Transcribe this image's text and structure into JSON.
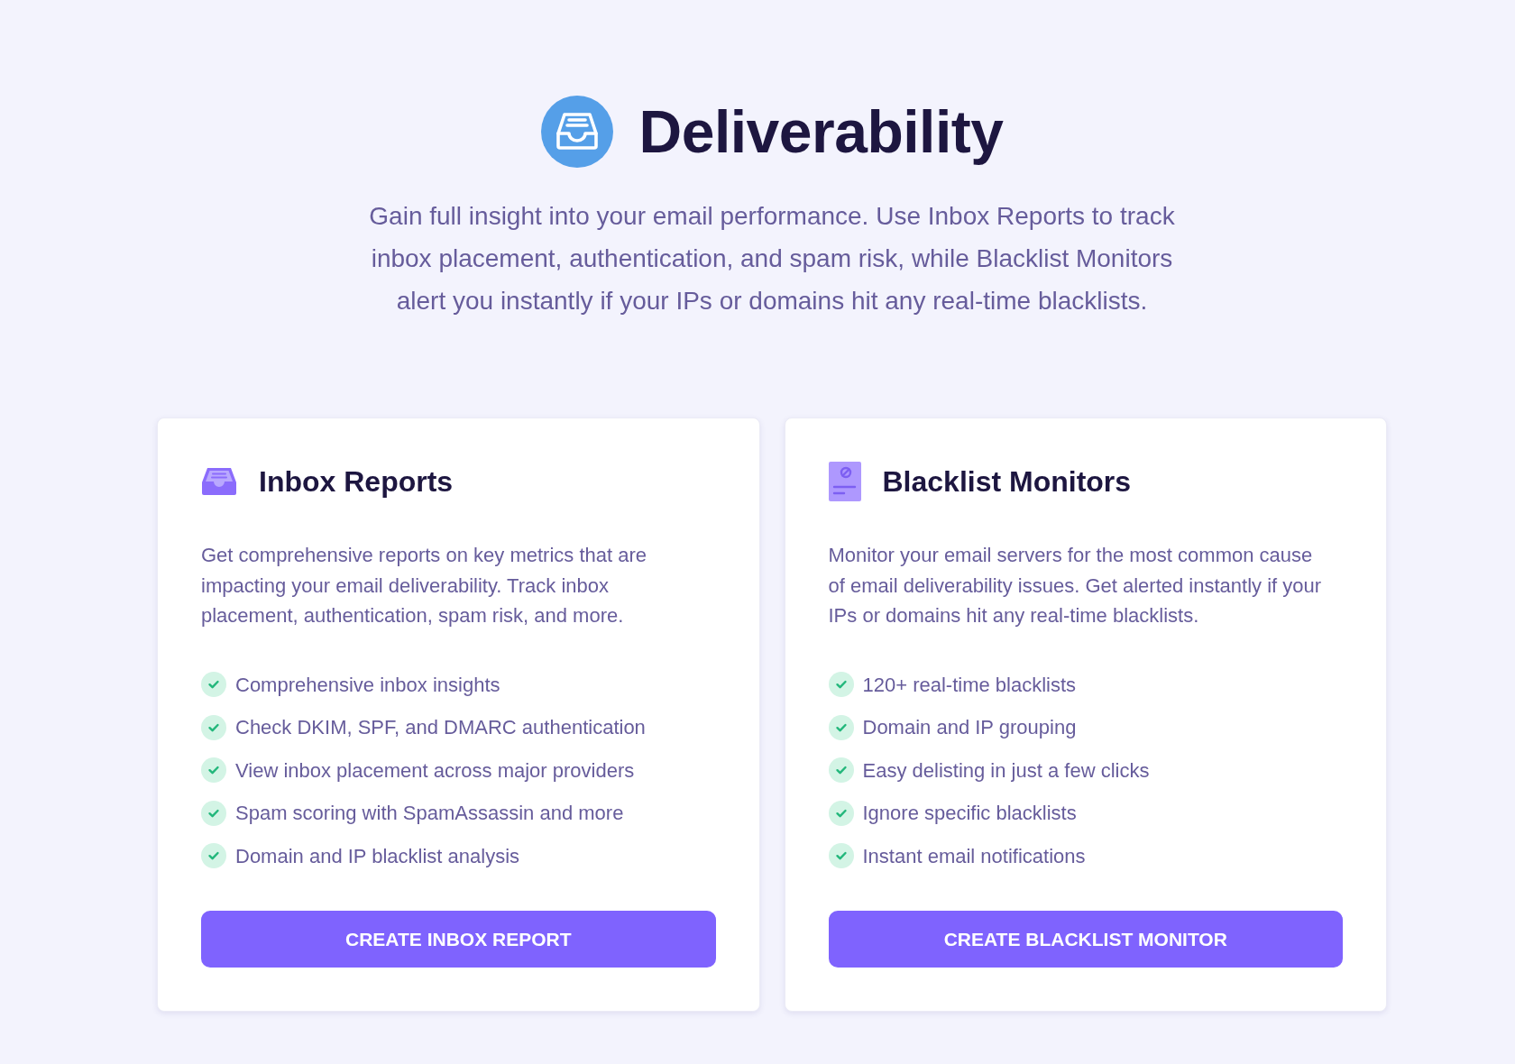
{
  "header": {
    "title": "Deliverability",
    "description": "Gain full insight into your email performance. Use Inbox Reports to track inbox placement, authentication, and spam risk, while Blacklist Monitors alert you instantly if your IPs or domains hit any real-time blacklists."
  },
  "cards": [
    {
      "kind": "inbox",
      "title": "Inbox Reports",
      "description": "Get comprehensive reports on key metrics that are impacting your email deliverability. Track inbox placement, authentication, spam risk, and more.",
      "features": [
        "Comprehensive inbox insights",
        "Check DKIM, SPF, and DMARC authentication",
        "View inbox placement across major providers",
        "Spam scoring with SpamAssassin and more",
        "Domain and IP blacklist analysis"
      ],
      "button": "CREATE INBOX REPORT"
    },
    {
      "kind": "blacklist",
      "title": "Blacklist Monitors",
      "description": "Monitor your email servers for the most common cause of email deliverability issues. Get alerted instantly if your IPs or domains hit any real-time blacklists.",
      "features": [
        "120+ real-time blacklists",
        "Domain and IP grouping",
        "Easy delisting in just a few clicks",
        "Ignore specific blacklists",
        "Instant email notifications"
      ],
      "button": "CREATE BLACKLIST MONITOR"
    }
  ]
}
